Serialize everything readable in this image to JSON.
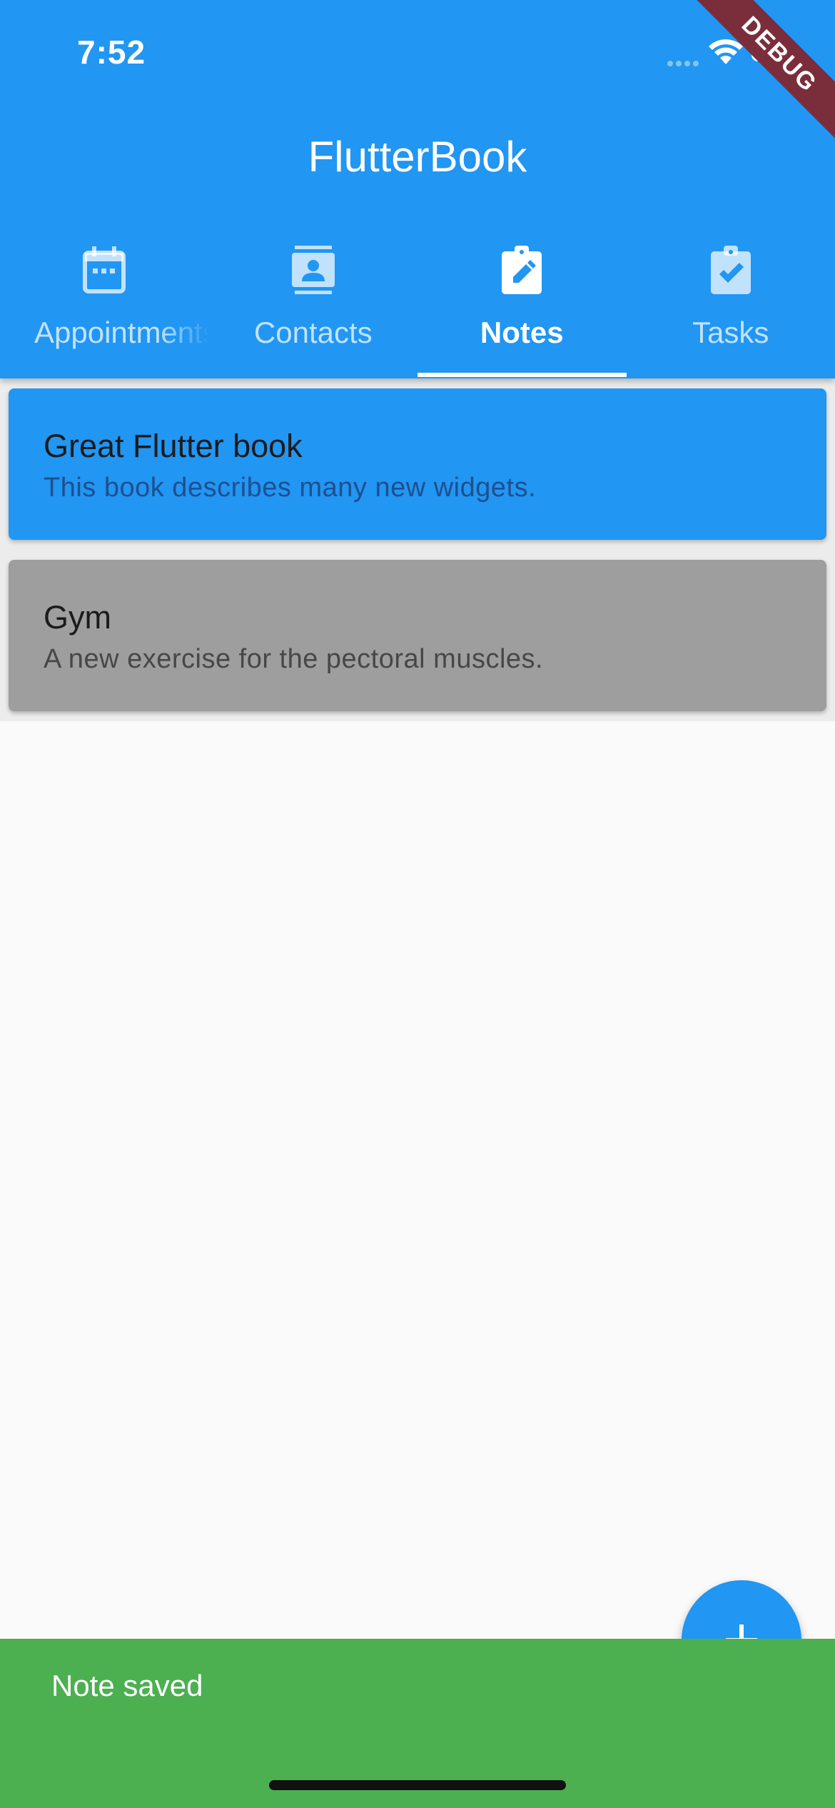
{
  "status_bar": {
    "time": "7:52"
  },
  "debug_banner": "DEBUG",
  "app_bar": {
    "title": "FlutterBook"
  },
  "tabs": [
    {
      "label": "Appointments",
      "icon": "calendar-icon",
      "active": false
    },
    {
      "label": "Contacts",
      "icon": "contact-card-icon",
      "active": false
    },
    {
      "label": "Notes",
      "icon": "clipboard-edit-icon",
      "active": true
    },
    {
      "label": "Tasks",
      "icon": "clipboard-check-icon",
      "active": false
    }
  ],
  "notes": [
    {
      "title": "Great Flutter book",
      "content": "This book describes many new widgets.",
      "color": "#2196f3"
    },
    {
      "title": "Gym",
      "content": "A new exercise for the pectoral muscles.",
      "color": "#9e9e9e"
    }
  ],
  "fab": {
    "icon": "add-icon"
  },
  "snackbar": {
    "message": "Note saved",
    "color": "#4caf50"
  },
  "colors": {
    "primary": "#2196f3",
    "background": "#fafafa"
  }
}
